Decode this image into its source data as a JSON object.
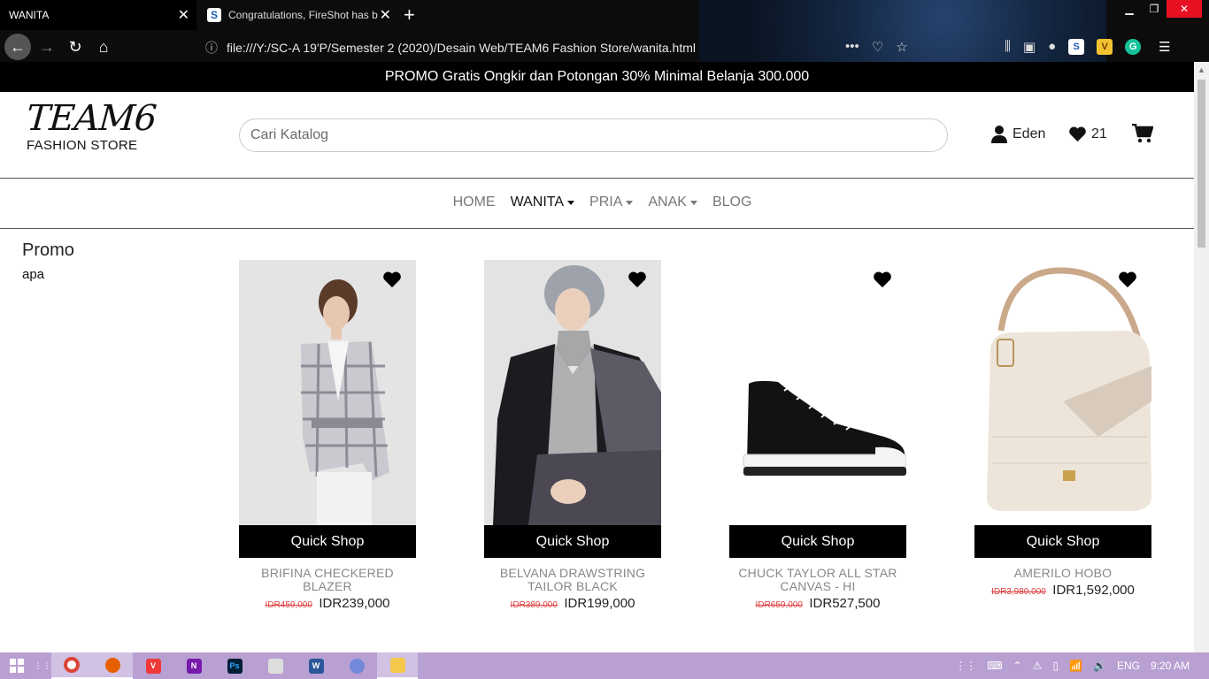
{
  "browser": {
    "tabs": [
      {
        "title": "WANITA",
        "active": true
      },
      {
        "title": "Congratulations, FireShot has b",
        "active": false
      }
    ],
    "url": "file:///Y:/SC-A 19'P/Semester 2 (2020)/Desain Web/TEAM6 Fashion Store/wanita.html"
  },
  "promo": "PROMO Gratis Ongkir dan Potongan 30% Minimal Belanja 300.000",
  "logo": {
    "main": "TEAM6",
    "sub": "FASHION STORE"
  },
  "search": {
    "placeholder": "Cari Katalog"
  },
  "user": {
    "name": "Eden"
  },
  "wishlist": {
    "count": "21"
  },
  "menu": [
    {
      "label": "HOME",
      "dropdown": false,
      "active": false
    },
    {
      "label": "WANITA",
      "dropdown": true,
      "active": true
    },
    {
      "label": "PRIA",
      "dropdown": true,
      "active": false
    },
    {
      "label": "ANAK",
      "dropdown": true,
      "active": false
    },
    {
      "label": "BLOG",
      "dropdown": false,
      "active": false
    }
  ],
  "sidebar": {
    "title": "Promo",
    "text": "apa"
  },
  "products": [
    {
      "name": "BRIFINA CHECKERED BLAZER",
      "old_price": "IDR459,000",
      "price": "IDR239,000",
      "button": "Quick Shop"
    },
    {
      "name": "BELVANA DRAWSTRING TAILOR BLACK",
      "old_price": "IDR389,000",
      "price": "IDR199,000",
      "button": "Quick Shop"
    },
    {
      "name": "CHUCK TAYLOR ALL STAR CANVAS - HI",
      "old_price": "IDR659,000",
      "price": "IDR527,500",
      "button": "Quick Shop"
    },
    {
      "name": "AMERILO HOBO",
      "old_price": "IDR3,980,000",
      "price": "IDR1,592,000",
      "button": "Quick Shop"
    }
  ],
  "taskbar": {
    "language": "ENG",
    "time": "9:20 AM"
  },
  "colors": {
    "accent": "#000000",
    "strike_price": "#e04040",
    "menu_inactive": "#777777",
    "taskbar": "#b9a0d3"
  }
}
